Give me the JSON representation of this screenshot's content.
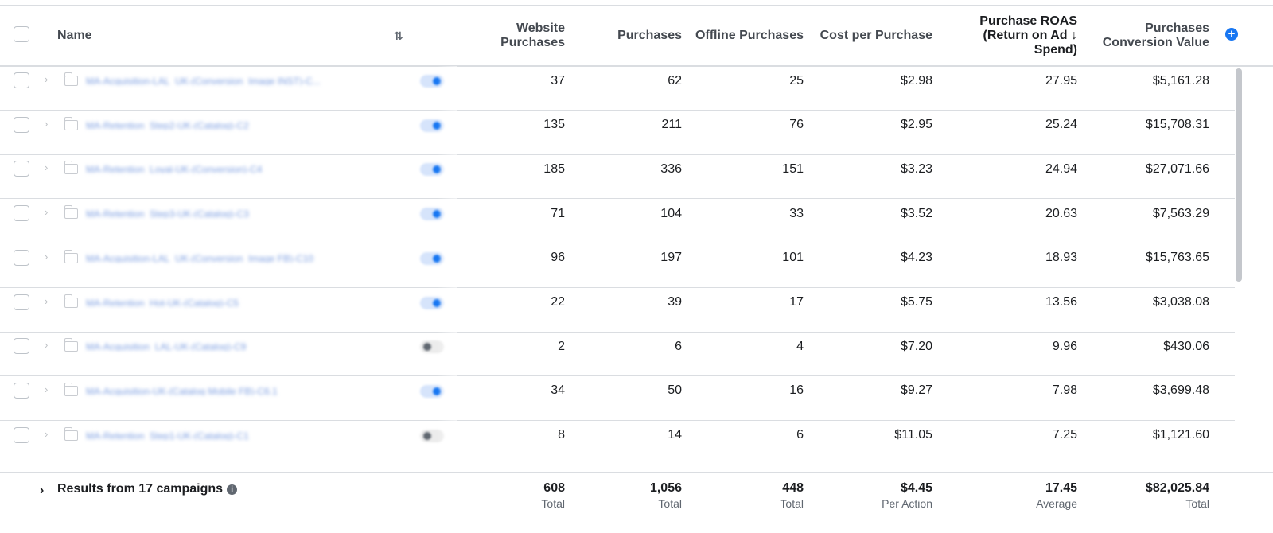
{
  "header": {
    "name": "Name",
    "website_purchases": [
      "Website",
      "Purchases"
    ],
    "purchases": "Purchases",
    "offline_purchases": "Offline Purchases",
    "cost_per_purchase": "Cost per Purchase",
    "roas": [
      "Purchase ROAS",
      "(Return on Ad ↓",
      "Spend)"
    ],
    "conversion_value": [
      "Purchases",
      "Conversion Value"
    ]
  },
  "rows": [
    {
      "name": "MA-Acquisition-LAL_UK-(Conversion_Image INST)-C...",
      "active": true,
      "website": "37",
      "purchases": "62",
      "offline": "25",
      "cpp": "$2.98",
      "roas": "27.95",
      "value": "$5,161.28"
    },
    {
      "name": "MA-Retention_Step2-UK-(Catalog)-C2",
      "active": true,
      "website": "135",
      "purchases": "211",
      "offline": "76",
      "cpp": "$2.95",
      "roas": "25.24",
      "value": "$15,708.31"
    },
    {
      "name": "MA-Retention_Loyal-UK-(Conversion)-C4",
      "active": true,
      "website": "185",
      "purchases": "336",
      "offline": "151",
      "cpp": "$3.23",
      "roas": "24.94",
      "value": "$27,071.66"
    },
    {
      "name": "MA-Retention_Step3-UK-(Catalog)-C3",
      "active": true,
      "website": "71",
      "purchases": "104",
      "offline": "33",
      "cpp": "$3.52",
      "roas": "20.63",
      "value": "$7,563.29"
    },
    {
      "name": "MA-Acquisition-LAL_UK-(Conversion_Image FB)-C10",
      "active": true,
      "website": "96",
      "purchases": "197",
      "offline": "101",
      "cpp": "$4.23",
      "roas": "18.93",
      "value": "$15,763.65"
    },
    {
      "name": "MA-Retention_Hot-UK-(Catalog)-C5",
      "active": true,
      "website": "22",
      "purchases": "39",
      "offline": "17",
      "cpp": "$5.75",
      "roas": "13.56",
      "value": "$3,038.08"
    },
    {
      "name": "MA-Acquisition_LAL-UK-(Catalog)-C9",
      "active": false,
      "website": "2",
      "purchases": "6",
      "offline": "4",
      "cpp": "$7.20",
      "roas": "9.96",
      "value": "$430.06"
    },
    {
      "name": "MA-Acquisition-UK-(Catalog Mobile FB)-C6.1",
      "active": true,
      "website": "34",
      "purchases": "50",
      "offline": "16",
      "cpp": "$9.27",
      "roas": "7.98",
      "value": "$3,699.48"
    },
    {
      "name": "MA-Retention_Step1-UK-(Catalog)-C1",
      "active": false,
      "website": "8",
      "purchases": "14",
      "offline": "6",
      "cpp": "$11.05",
      "roas": "7.25",
      "value": "$1,121.60"
    }
  ],
  "footer": {
    "results": "Results from 17 campaigns",
    "website": {
      "value": "608",
      "label": "Total"
    },
    "purchases": {
      "value": "1,056",
      "label": "Total"
    },
    "offline": {
      "value": "448",
      "label": "Total"
    },
    "cpp": {
      "value": "$4.45",
      "label": "Per Action"
    },
    "roas": {
      "value": "17.45",
      "label": "Average"
    },
    "conversion_value": {
      "value": "$82,025.84",
      "label": "Total"
    }
  },
  "icons": {
    "sort": "sort-arrows-icon",
    "add_column": "plus-circle-icon",
    "info": "info-icon",
    "expand": "chevron-right-icon",
    "folder": "folder-icon"
  },
  "colors": {
    "accent": "#1877f2",
    "border": "#dadde1",
    "text": "#1c1e21",
    "muted": "#606770"
  }
}
